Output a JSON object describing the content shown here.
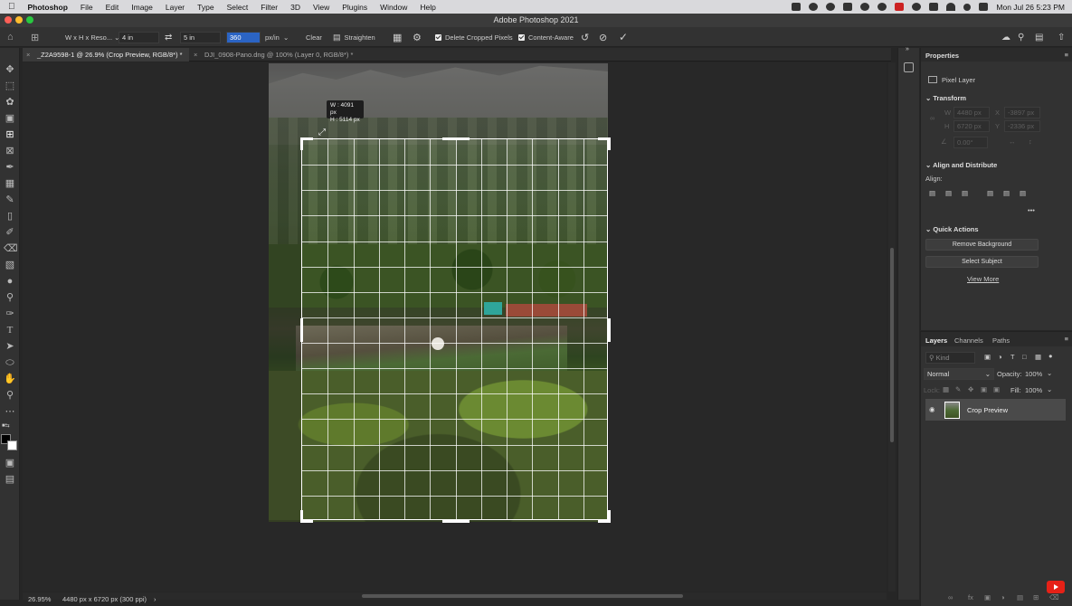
{
  "menubar": {
    "app_name": "Photoshop",
    "items": [
      "File",
      "Edit",
      "Image",
      "Layer",
      "Type",
      "Select",
      "Filter",
      "3D",
      "View",
      "Plugins",
      "Window",
      "Help"
    ],
    "clock": "Mon Jul 26  5:23 PM"
  },
  "window": {
    "title": "Adobe Photoshop 2021"
  },
  "options_bar": {
    "ratio_preset": "W x H x Reso...",
    "width": "4 in",
    "height": "5 in",
    "resolution": "360",
    "resolution_unit": "px/in",
    "clear_label": "Clear",
    "straighten_label": "Straighten",
    "delete_cropped_label": "Delete Cropped Pixels",
    "content_aware_label": "Content-Aware"
  },
  "doc_tabs": [
    {
      "label": "_Z2A9598-1 @ 26.9% (Crop Preview, RGB/8*) *",
      "active": true
    },
    {
      "label": "DJI_0908-Pano.dng @ 100% (Layer 0, RGB/8*) *",
      "active": false
    }
  ],
  "crop_tooltip": {
    "w": "W : 4091 px",
    "h": "H : 5114 px"
  },
  "status": {
    "zoom": "26.95%",
    "doc_info": "4480 px x 6720 px (300 ppi)"
  },
  "properties": {
    "title": "Properties",
    "layer_kind": "Pixel Layer",
    "transform_label": "Transform",
    "w_label": "W",
    "w_value": "4480 px",
    "x_label": "X",
    "x_value": "-3897 px",
    "h_label": "H",
    "h_value": "6720 px",
    "y_label": "Y",
    "y_value": "-2336 px",
    "angle_value": "0.00°",
    "align_section": "Align and Distribute",
    "align_label": "Align:",
    "more": "•••",
    "quick_actions": "Quick Actions",
    "remove_bg": "Remove Background",
    "select_subject": "Select Subject",
    "view_more": "View More"
  },
  "layers_panel": {
    "tabs": [
      "Layers",
      "Channels",
      "Paths"
    ],
    "kind_placeholder": "Kind",
    "blend_mode": "Normal",
    "opacity_label": "Opacity:",
    "opacity_value": "100%",
    "lock_label": "Lock:",
    "fill_label": "Fill:",
    "fill_value": "100%",
    "layer_name": "Crop Preview"
  }
}
